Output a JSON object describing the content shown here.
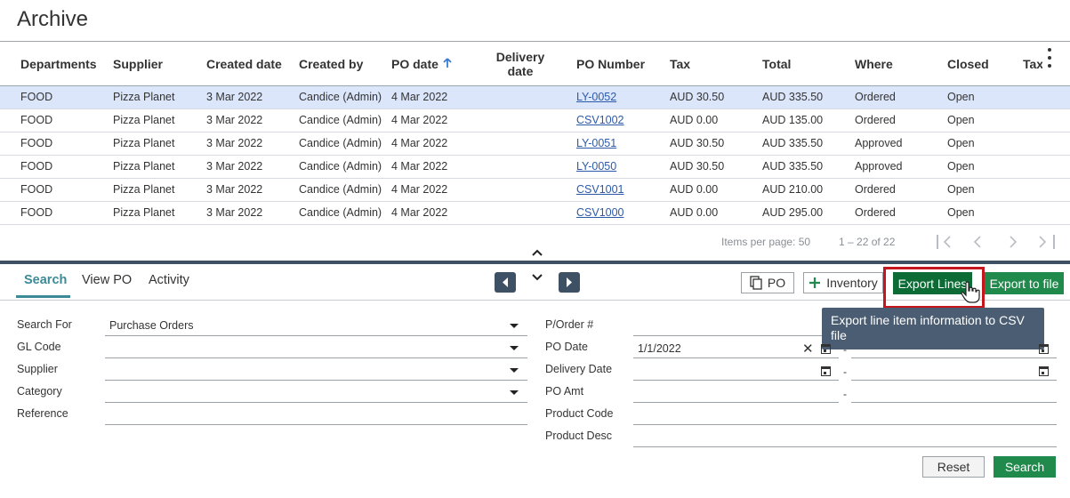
{
  "page": {
    "title": "Archive"
  },
  "table": {
    "columns": [
      "Departments",
      "Supplier",
      "Created date",
      "Created by",
      "PO date",
      "Delivery date",
      "PO Number",
      "Tax",
      "Total",
      "Where",
      "Closed",
      "Tax"
    ],
    "sort": {
      "column": "PO date",
      "direction": "ascending",
      "icon": "arrow-up-icon"
    },
    "rows": [
      [
        "FOOD",
        "Pizza Planet",
        "3 Mar 2022",
        "Candice (Admin)",
        "4 Mar 2022",
        "",
        "LY-0052",
        "AUD 30.50",
        "AUD 335.50",
        "Ordered",
        "Open"
      ],
      [
        "FOOD",
        "Pizza Planet",
        "3 Mar 2022",
        "Candice (Admin)",
        "4 Mar 2022",
        "",
        "CSV1002",
        "AUD 0.00",
        "AUD 135.00",
        "Ordered",
        "Open"
      ],
      [
        "FOOD",
        "Pizza Planet",
        "3 Mar 2022",
        "Candice (Admin)",
        "4 Mar 2022",
        "",
        "LY-0051",
        "AUD 30.50",
        "AUD 335.50",
        "Approved",
        "Open"
      ],
      [
        "FOOD",
        "Pizza Planet",
        "3 Mar 2022",
        "Candice (Admin)",
        "4 Mar 2022",
        "",
        "LY-0050",
        "AUD 30.50",
        "AUD 335.50",
        "Approved",
        "Open"
      ],
      [
        "FOOD",
        "Pizza Planet",
        "3 Mar 2022",
        "Candice (Admin)",
        "4 Mar 2022",
        "",
        "CSV1001",
        "AUD 0.00",
        "AUD 210.00",
        "Ordered",
        "Open"
      ],
      [
        "FOOD",
        "Pizza Planet",
        "3 Mar 2022",
        "Candice (Admin)",
        "4 Mar 2022",
        "",
        "CSV1000",
        "AUD 0.00",
        "AUD 295.00",
        "Ordered",
        "Open"
      ]
    ],
    "selected_row": 0
  },
  "pager": {
    "items_label": "Items per page:",
    "items_value": "50",
    "range": "1 – 22 of 22"
  },
  "tabs": [
    {
      "label": "Search",
      "active": true
    },
    {
      "label": "View PO",
      "active": false
    },
    {
      "label": "Activity",
      "active": false
    }
  ],
  "toolbar": {
    "po_label": "PO",
    "inventory_label": "Inventory",
    "export_lines_label": "Export Lines",
    "export_file_label": "Export to file",
    "tooltip": "Export line item information to CSV file"
  },
  "form": {
    "search_for_label": "Search For",
    "search_for_value": "Purchase Orders",
    "gl_code_label": "GL Code",
    "supplier_label": "Supplier",
    "category_label": "Category",
    "reference_label": "Reference",
    "porder_label": "P/Order #",
    "po_date_label": "PO Date",
    "po_date_from": "1/1/2022",
    "delivery_date_label": "Delivery Date",
    "po_amt_label": "PO Amt",
    "product_code_label": "Product Code",
    "product_desc_label": "Product Desc",
    "range_separator": "-",
    "reset_label": "Reset",
    "search_label": "Search"
  },
  "colors": {
    "accent_teal": "#3b8a96",
    "green": "#1f8a4c",
    "dark_green": "#0d6b36",
    "highlight_red": "#c4161c",
    "navy": "#3d5064",
    "selected_row": "#dce6fb"
  }
}
